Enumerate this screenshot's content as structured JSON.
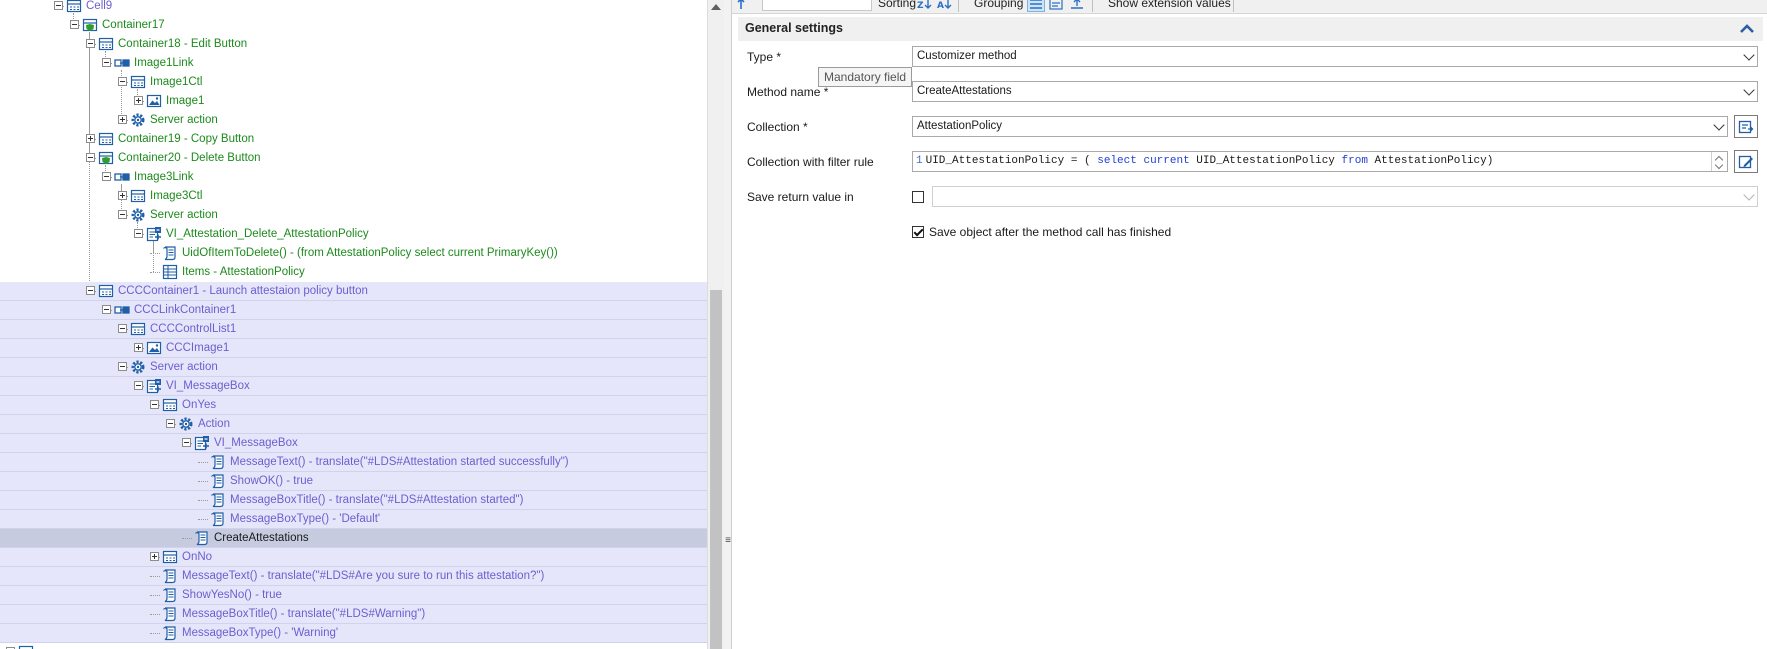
{
  "tree": {
    "rows": [
      {
        "label": "Cell9",
        "color": "purple",
        "icon": "container-icon",
        "toggle": "minus",
        "depth": 3,
        "hl": false
      },
      {
        "label": "Container17",
        "color": "green",
        "icon": "shield-container-icon",
        "toggle": "minus",
        "depth": 4,
        "hl": false
      },
      {
        "label": "Container18 - Edit Button",
        "color": "green",
        "icon": "container-icon",
        "toggle": "minus",
        "depth": 5,
        "hl": false
      },
      {
        "label": "Image1Link",
        "color": "green",
        "icon": "link-icon",
        "toggle": "minus",
        "depth": 6,
        "hl": false
      },
      {
        "label": "Image1Ctl",
        "color": "green",
        "icon": "container-icon",
        "toggle": "minus",
        "depth": 7,
        "hl": false
      },
      {
        "label": "Image1",
        "color": "green",
        "icon": "image-icon",
        "toggle": "plus",
        "depth": 8,
        "hl": false
      },
      {
        "label": "Server action",
        "color": "green",
        "icon": "gear-icon",
        "toggle": "plus",
        "depth": 7,
        "hl": false
      },
      {
        "label": "Container19 - Copy Button",
        "color": "green",
        "icon": "container-icon",
        "toggle": "plus",
        "depth": 5,
        "hl": false
      },
      {
        "label": "Container20 - Delete Button",
        "color": "green",
        "icon": "shield-container-icon",
        "toggle": "minus",
        "depth": 5,
        "hl": false
      },
      {
        "label": "Image3Link",
        "color": "green",
        "icon": "link-icon",
        "toggle": "minus",
        "depth": 6,
        "hl": false
      },
      {
        "label": "Image3Ctl",
        "color": "green",
        "icon": "container-icon",
        "toggle": "plus",
        "depth": 7,
        "hl": false
      },
      {
        "label": "Server action",
        "color": "green",
        "icon": "gear-icon",
        "toggle": "minus",
        "depth": 7,
        "hl": false
      },
      {
        "label": "VI_Attestation_Delete_AttestationPolicy",
        "color": "green",
        "icon": "script-call-icon",
        "toggle": "minus",
        "depth": 8,
        "hl": false
      },
      {
        "label": "UidOfItemToDelete() - (from AttestationPolicy select current PrimaryKey())",
        "color": "green",
        "icon": "script-icon",
        "toggle": "none",
        "depth": 9,
        "hl": false
      },
      {
        "label": "Items - AttestationPolicy",
        "color": "green",
        "icon": "table-icon",
        "toggle": "none",
        "depth": 9,
        "hl": false
      },
      {
        "label": "CCCContainer1 - Launch attestaion policy button",
        "color": "purple",
        "icon": "container-icon",
        "toggle": "minus",
        "depth": 5,
        "hl": true
      },
      {
        "label": "CCCLinkContainer1",
        "color": "purple",
        "icon": "link-icon",
        "toggle": "minus",
        "depth": 6,
        "hl": true
      },
      {
        "label": "CCCControlList1",
        "color": "purple",
        "icon": "container-icon",
        "toggle": "minus",
        "depth": 7,
        "hl": true
      },
      {
        "label": "CCCImage1",
        "color": "purple",
        "icon": "image-icon",
        "toggle": "plus",
        "depth": 8,
        "hl": true
      },
      {
        "label": "Server action",
        "color": "purple",
        "icon": "gear-icon",
        "toggle": "minus",
        "depth": 7,
        "hl": true
      },
      {
        "label": "VI_MessageBox",
        "color": "purple",
        "icon": "script-call-icon",
        "toggle": "minus",
        "depth": 8,
        "hl": true
      },
      {
        "label": "OnYes",
        "color": "purple",
        "icon": "container-icon",
        "toggle": "minus",
        "depth": 9,
        "hl": true
      },
      {
        "label": "Action",
        "color": "purple",
        "icon": "gear-icon",
        "toggle": "minus",
        "depth": 10,
        "hl": true
      },
      {
        "label": "VI_MessageBox",
        "color": "purple",
        "icon": "script-call-icon",
        "toggle": "minus",
        "depth": 11,
        "hl": true
      },
      {
        "label": "MessageText() - translate(\"#LDS#Attestation started successfully\")",
        "color": "purple",
        "icon": "script-icon",
        "toggle": "none",
        "depth": 12,
        "hl": true
      },
      {
        "label": "ShowOK() - true",
        "color": "purple",
        "icon": "script-icon",
        "toggle": "none",
        "depth": 12,
        "hl": true
      },
      {
        "label": "MessageBoxTitle() - translate(\"#LDS#Attestation started\")",
        "color": "purple",
        "icon": "script-icon",
        "toggle": "none",
        "depth": 12,
        "hl": true
      },
      {
        "label": "MessageBoxType() - 'Default'",
        "color": "purple",
        "icon": "script-icon",
        "toggle": "none",
        "depth": 12,
        "hl": true
      },
      {
        "label": "CreateAttestations",
        "color": "black",
        "icon": "script-icon",
        "toggle": "none",
        "depth": 11,
        "hl": true,
        "selected": true
      },
      {
        "label": "OnNo",
        "color": "purple",
        "icon": "container-icon",
        "toggle": "plus",
        "depth": 9,
        "hl": true
      },
      {
        "label": "MessageText() - translate(\"#LDS#Are you sure to run this attestation?\")",
        "color": "purple",
        "icon": "script-icon",
        "toggle": "none",
        "depth": 9,
        "hl": true
      },
      {
        "label": "ShowYesNo() - true",
        "color": "purple",
        "icon": "script-icon",
        "toggle": "none",
        "depth": 9,
        "hl": true
      },
      {
        "label": "MessageBoxTitle() - translate(\"#LDS#Warning\")",
        "color": "purple",
        "icon": "script-icon",
        "toggle": "none",
        "depth": 9,
        "hl": true
      },
      {
        "label": "MessageBoxType() - 'Warning'",
        "color": "purple",
        "icon": "script-icon",
        "toggle": "none",
        "depth": 9,
        "hl": true
      },
      {
        "label": "",
        "color": "purple",
        "icon": "container-icon",
        "toggle": "plus",
        "depth": 0,
        "hl": false
      }
    ]
  },
  "toolbar": {
    "sorting_label": "Sorting",
    "grouping_label": "Grouping",
    "extension_label": "Show extension values"
  },
  "section": {
    "title": "General settings"
  },
  "form": {
    "type_label": "Type *",
    "type_value": "Customizer method",
    "method_label": "Method name *",
    "method_value": "CreateAttestations",
    "collection_label": "Collection *",
    "collection_value": "AttestationPolicy",
    "filter_label": "Collection with filter rule",
    "filter_line": "1",
    "filter_part1": "UID_AttestationPolicy = ( ",
    "filter_kw1": "select",
    "filter_kw2": "current",
    "filter_part2": " UID_AttestationPolicy ",
    "filter_kw3": "from",
    "filter_part3": " AttestationPolicy)",
    "save_return_label": "Save return value in",
    "save_return_value": "",
    "save_object_label": "Save object after the method call has finished",
    "save_object_checked": true,
    "save_return_checked": false
  },
  "tooltip": {
    "text": "Mandatory field"
  },
  "colors": {
    "green": "#1d8a1d",
    "purple": "#6b5fd0",
    "highlight": "#e6e6fa",
    "selected": "#c6cbe0",
    "keyword": "#1f3fd6"
  }
}
